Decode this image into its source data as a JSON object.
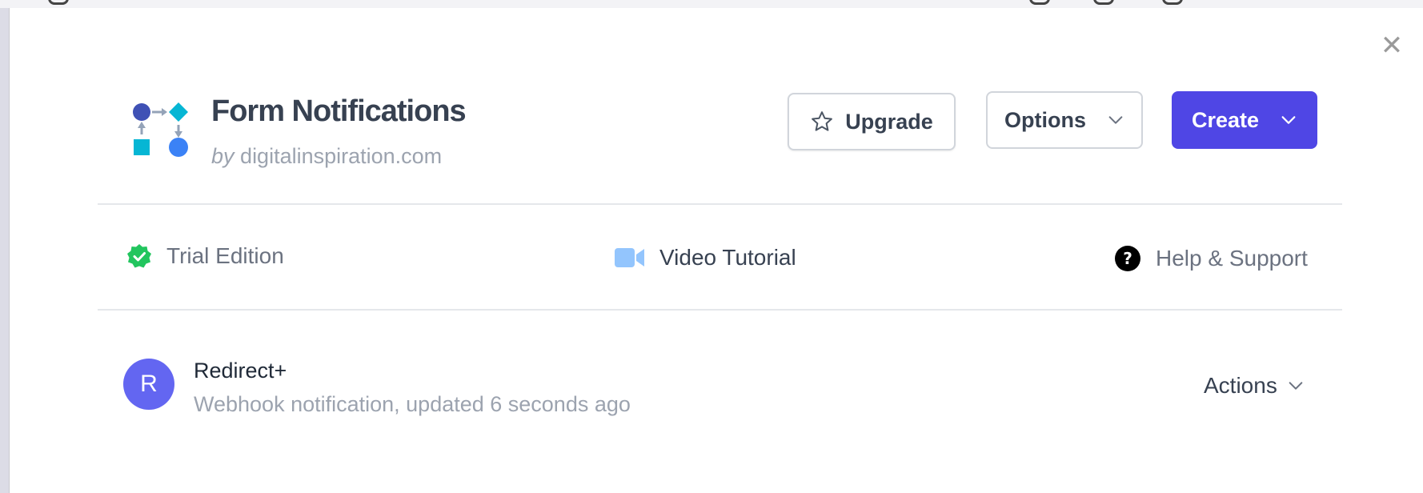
{
  "app": {
    "title": "Form Notifications",
    "by_prefix": "by",
    "by_domain": "digitalinspiration.com"
  },
  "buttons": {
    "upgrade": "Upgrade",
    "options": "Options",
    "create": "Create",
    "close_icon": "close-icon"
  },
  "info_bar": {
    "trial": "Trial Edition",
    "video": "Video Tutorial",
    "help": "Help & Support"
  },
  "notifications": [
    {
      "avatar_letter": "R",
      "name": "Redirect+",
      "subtitle": "Webhook notification, updated 6 seconds ago",
      "actions_label": "Actions"
    }
  ],
  "colors": {
    "primary": "#4f46e5",
    "avatar": "#6366f1",
    "trial_check": "#22c55e",
    "video_icon": "#93c5fd",
    "logo_dark_blue": "#3f51b5",
    "logo_cyan": "#06b6d4",
    "logo_blue": "#3b82f6"
  },
  "icons": {
    "logo": "workflow-logo-icon",
    "upgrade": "star-icon",
    "dropdown": "chevron-down-icon",
    "trial": "check-badge-icon",
    "video": "video-camera-icon",
    "help": "question-circle-icon"
  }
}
